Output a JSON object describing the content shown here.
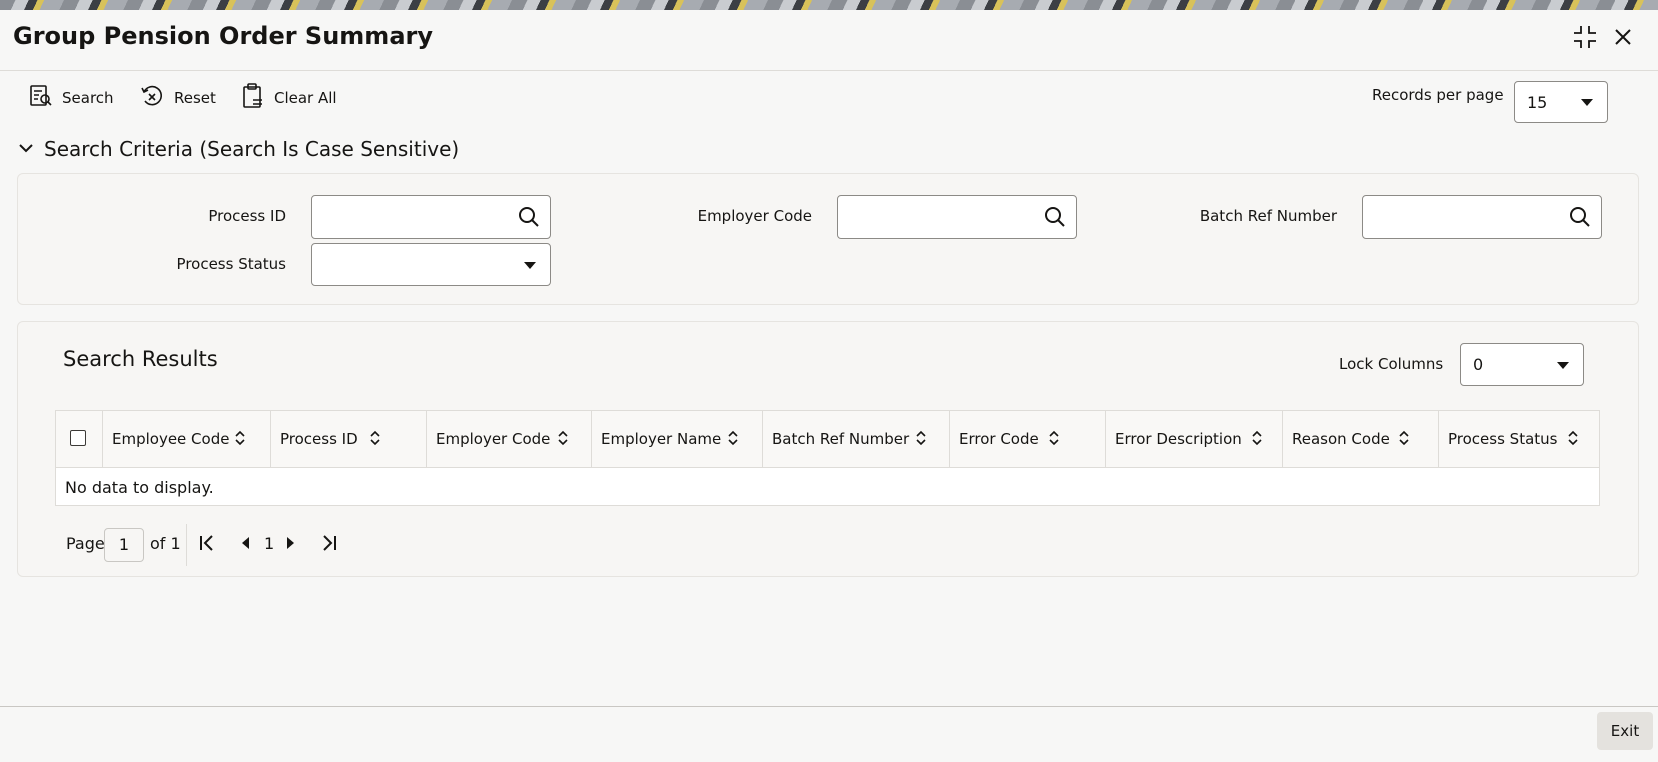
{
  "window": {
    "title": "Group Pension Order Summary"
  },
  "toolbar": {
    "search_label": "Search",
    "reset_label": "Reset",
    "clear_all_label": "Clear All",
    "records_per_page_label": "Records per page",
    "records_per_page_value": "15"
  },
  "criteria": {
    "header": "Search Criteria (Search Is Case Sensitive)",
    "process_id_label": "Process ID",
    "process_id_value": "",
    "employer_code_label": "Employer Code",
    "employer_code_value": "",
    "batch_ref_label": "Batch Ref Number",
    "batch_ref_value": "",
    "process_status_label": "Process Status",
    "process_status_value": ""
  },
  "results": {
    "title": "Search Results",
    "lock_columns_label": "Lock Columns",
    "lock_columns_value": "0",
    "columns": [
      "Employee Code",
      "Process ID",
      "Employer Code",
      "Employer Name",
      "Batch Ref Number",
      "Error Code",
      "Error Description",
      "Reason Code",
      "Process Status"
    ],
    "empty_message": "No data to display."
  },
  "pagination": {
    "page_label": "Page",
    "current_page": "1",
    "of_label": "of 1",
    "page_number": "1"
  },
  "footer": {
    "exit_label": "Exit"
  },
  "icons": {
    "search": "search-icon",
    "reset": "reset-icon",
    "clear_all": "clipboard-clear-icon",
    "minimize": "collapse-icon",
    "close": "close-icon",
    "chevron": "chevron-down-icon",
    "magnifier": "magnifier-icon",
    "sort": "sort-icon",
    "first": "first-page-icon",
    "prev": "previous-page-icon",
    "next": "next-page-icon",
    "last": "last-page-icon"
  },
  "colors": {
    "text": "#161513",
    "border": "#8c8a86",
    "panel": "#f7f6f4"
  }
}
